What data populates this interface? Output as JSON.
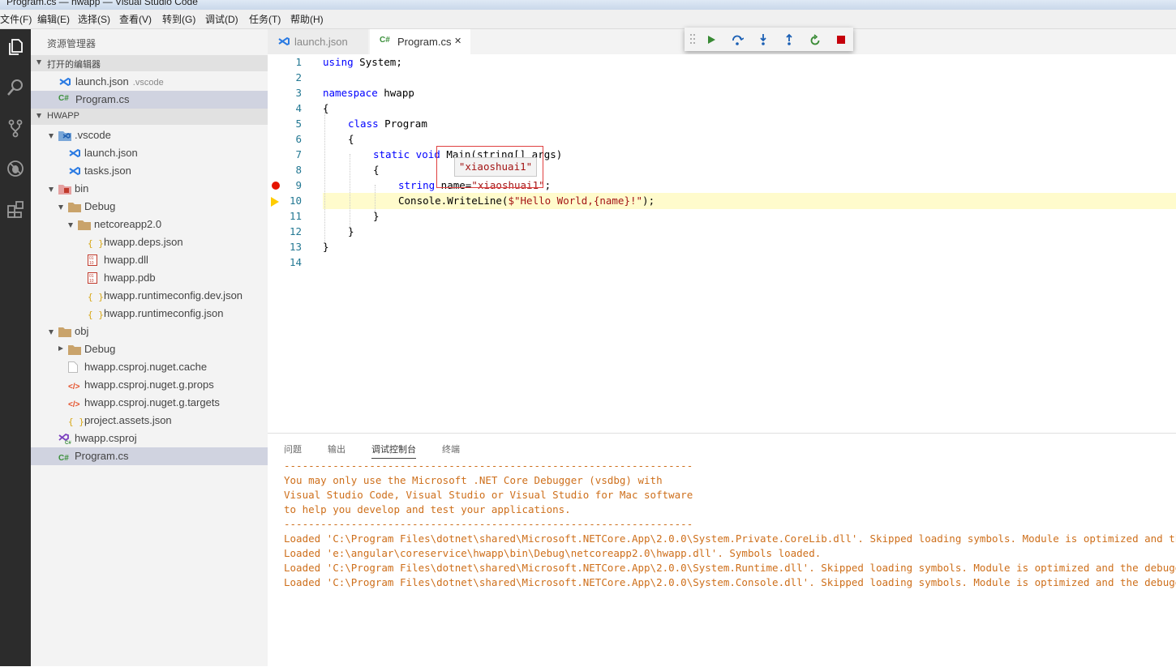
{
  "window": {
    "title": "Program.cs — hwapp — Visual Studio Code"
  },
  "menu": [
    "文件(F)",
    "编辑(E)",
    "选择(S)",
    "查看(V)",
    "转到(G)",
    "调试(D)",
    "任务(T)",
    "帮助(H)"
  ],
  "activity_bar": [
    "explorer-icon",
    "search-icon",
    "source-control-icon",
    "debug-icon",
    "extensions-icon"
  ],
  "sidebar": {
    "title": "资源管理器",
    "open_editors": {
      "label": "打开的编辑器",
      "items": [
        {
          "name": "launch.json",
          "desc": ".vscode"
        },
        {
          "name": "Program.cs",
          "desc": ""
        }
      ]
    },
    "project": {
      "label": "HWAPP",
      "tree": [
        ".vscode",
        "launch.json",
        "tasks.json",
        "bin",
        "Debug",
        "netcoreapp2.0",
        "hwapp.deps.json",
        "hwapp.dll",
        "hwapp.pdb",
        "hwapp.runtimeconfig.dev.json",
        "hwapp.runtimeconfig.json",
        "obj",
        "Debug",
        "hwapp.csproj.nuget.cache",
        "hwapp.csproj.nuget.g.props",
        "hwapp.csproj.nuget.g.targets",
        "project.assets.json",
        "hwapp.csproj",
        "Program.cs"
      ]
    }
  },
  "tabs": [
    {
      "label": "launch.json"
    },
    {
      "label": "Program.cs",
      "close": "✕"
    }
  ],
  "debug_toolbar": [
    "continue-icon",
    "step-over-icon",
    "step-into-icon",
    "step-out-icon",
    "restart-icon",
    "stop-icon"
  ],
  "editor": {
    "line_numbers": [
      "1",
      "2",
      "3",
      "4",
      "5",
      "6",
      "7",
      "8",
      "9",
      "10",
      "11",
      "12",
      "13",
      "14"
    ],
    "code": {
      "l1_kw": "using",
      "l1_rest": " System;",
      "l3_kw": "namespace",
      "l3_rest": " hwapp",
      "l4": "{",
      "l5_kw": "class",
      "l5_rest": " Program",
      "l6": "{",
      "l7_kw": "static void",
      "l7_rest": " Main(string[] args)",
      "l8": "{",
      "l9_kw": "string",
      "l9_a": " name=",
      "l9_str": "\"xiaoshuai1\"",
      "l9_b": ";",
      "l10_a": "Console.WriteLine(",
      "l10_str": "$\"Hello World,{name}!\"",
      "l10_b": ");",
      "l11": "}",
      "l12": "}",
      "l13": "}"
    },
    "breakpoint_line": "9",
    "current_line": "10",
    "hover_value": "\"xiaoshuai1\""
  },
  "panel": {
    "tabs": [
      "问题",
      "输出",
      "调试控制台",
      "终端"
    ],
    "active_tab": "调试控制台",
    "console_lines": [
      "-------------------------------------------------------------------",
      "You may only use the Microsoft .NET Core Debugger (vsdbg) with",
      "Visual Studio Code, Visual Studio or Visual Studio for Mac software",
      "to help you develop and test your applications.",
      "-------------------------------------------------------------------",
      "Loaded 'C:\\Program Files\\dotnet\\shared\\Microsoft.NETCore.App\\2.0.0\\System.Private.CoreLib.dll'. Skipped loading symbols. Module is optimized and the debugger option 'Just My Code' is enabled.",
      "Loaded 'e:\\angular\\coreservice\\hwapp\\bin\\Debug\\netcoreapp2.0\\hwapp.dll'. Symbols loaded.",
      "Loaded 'C:\\Program Files\\dotnet\\shared\\Microsoft.NETCore.App\\2.0.0\\System.Runtime.dll'. Skipped loading symbols. Module is optimized and the debugger option 'Just My Code' is enabled.",
      "Loaded 'C:\\Program Files\\dotnet\\shared\\Microsoft.NETCore.App\\2.0.0\\System.Console.dll'. Skipped loading symbols. Module is optimized and the debugger option 'Just My Code' is enabled."
    ]
  },
  "colors": {
    "accent": "#007acc",
    "keyword": "#0000ff",
    "string": "#a31515",
    "console_text": "#ce6f1b",
    "breakpoint": "#e51400",
    "current_line": "#fffbcc"
  }
}
